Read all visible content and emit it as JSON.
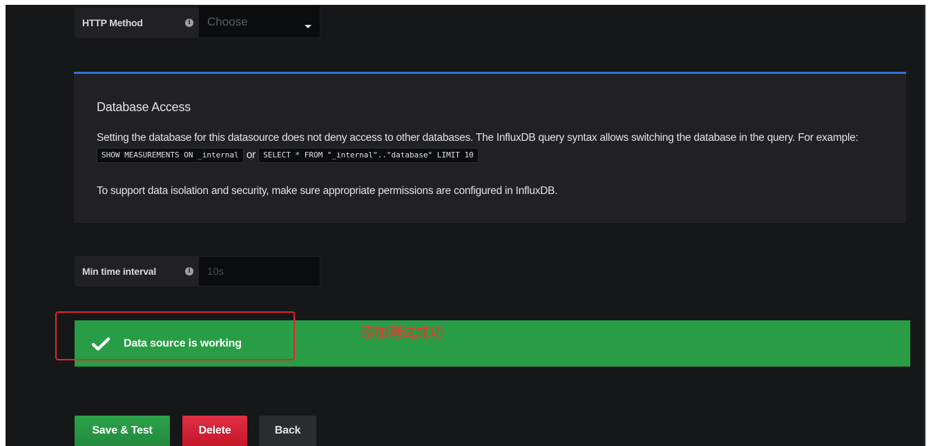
{
  "http_method": {
    "label": "HTTP Method",
    "placeholder": "Choose"
  },
  "database_access": {
    "title": "Database Access",
    "text_part1": "Setting the database for this datasource does not deny access to other databases. The InfluxDB query syntax allows switching the database in the query. For example: ",
    "code1": "SHOW MEASUREMENTS ON _internal",
    "text_or": " or ",
    "code2": "SELECT * FROM \"_internal\"..\"database\" LIMIT 10",
    "text2": "To support data isolation and security, make sure appropriate permissions are configured in InfluxDB."
  },
  "min_time_interval": {
    "label": "Min time interval",
    "placeholder": "10s"
  },
  "alert": {
    "message": "Data source is working",
    "annotation": "添加测试成功"
  },
  "buttons": {
    "save_test": "Save & Test",
    "delete": "Delete",
    "back": "Back"
  },
  "colors": {
    "background": "#161719",
    "panel": "#212124",
    "accent_blue": "#3274d9",
    "success": "#299c46",
    "danger": "#e02f44",
    "annotation_red": "#e3262c"
  },
  "icons": {
    "info": "info-icon",
    "dropdown": "chevron-down-icon",
    "success": "check-icon"
  }
}
